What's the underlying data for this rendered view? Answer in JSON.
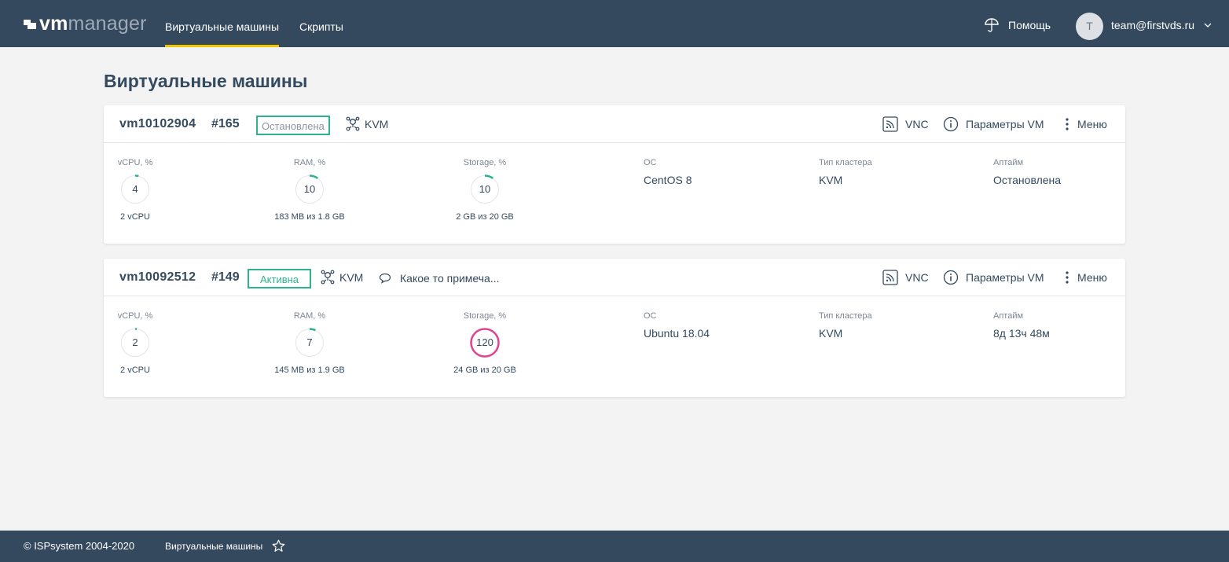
{
  "app": {
    "logo_vm": "vm",
    "logo_manager": "manager"
  },
  "header": {
    "tabs": [
      {
        "label": "Виртуальные машины",
        "active": true
      },
      {
        "label": "Скрипты",
        "active": false
      }
    ],
    "help_label": "Помощь",
    "user_initial": "T",
    "user_email": "team@firstvds.ru"
  },
  "page": {
    "title": "Виртуальные машины"
  },
  "vms": [
    {
      "name": "vm10102904",
      "id": "#165",
      "status": "Остановлена",
      "cluster": "KVM",
      "note": "",
      "actions": {
        "vnc": "VNC",
        "params": "Параметры VM",
        "menu": "Меню"
      },
      "metrics": [
        {
          "label": "vCPU, %",
          "value": "4",
          "percent": 4,
          "sub": "2 vCPU"
        },
        {
          "label": "RAM, %",
          "value": "10",
          "percent": 10,
          "sub": "183 MB из 1.8 GB"
        },
        {
          "label": "Storage, %",
          "value": "10",
          "percent": 10,
          "sub": "2 GB из 20 GB"
        }
      ],
      "info": [
        {
          "label": "ОС",
          "value": "CentOS 8"
        },
        {
          "label": "Тип кластера",
          "value": "KVM"
        },
        {
          "label": "Аптайм",
          "value": "Остановлена"
        }
      ]
    },
    {
      "name": "vm10092512",
      "id": "#149",
      "status": "Активна",
      "cluster": "KVM",
      "note": "Какое то примеча...",
      "actions": {
        "vnc": "VNC",
        "params": "Параметры VM",
        "menu": "Меню"
      },
      "metrics": [
        {
          "label": "vCPU, %",
          "value": "2",
          "percent": 2,
          "sub": "2 vCPU"
        },
        {
          "label": "RAM, %",
          "value": "7",
          "percent": 7,
          "sub": "145 MB из 1.9 GB"
        },
        {
          "label": "Storage, %",
          "value": "120",
          "percent": 120,
          "sub": "24 GB из 20 GB"
        }
      ],
      "info": [
        {
          "label": "ОС",
          "value": "Ubuntu 18.04"
        },
        {
          "label": "Тип кластера",
          "value": "KVM"
        },
        {
          "label": "Аптайм",
          "value": "8д 13ч 48м"
        }
      ]
    }
  ],
  "footer": {
    "copyright": "© ISPsystem 2004-2020",
    "breadcrumb": "Виртуальные машины"
  },
  "colors": {
    "header_bg": "#34495e",
    "accent_yellow": "#f2c500",
    "status_green": "#2db38f",
    "over_limit_pink": "#e0438f",
    "ring_track": "#e2e5e8"
  }
}
